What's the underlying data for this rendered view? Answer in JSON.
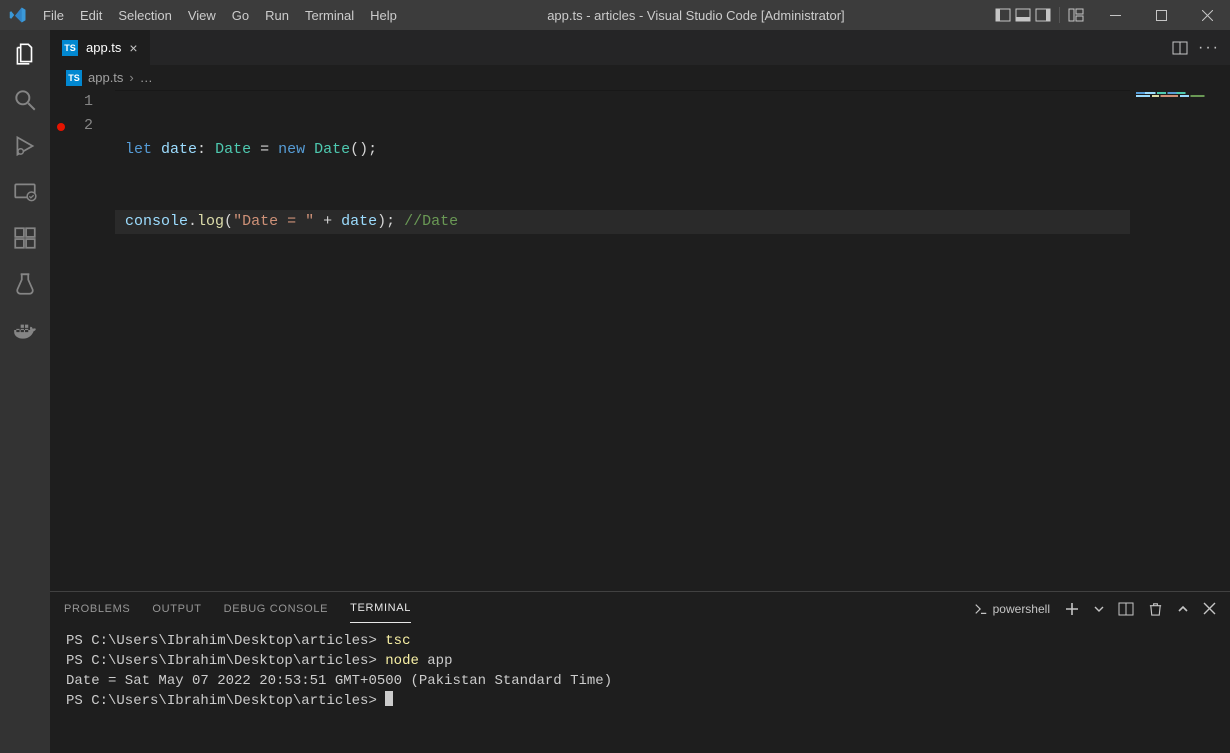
{
  "window": {
    "title": "app.ts - articles - Visual Studio Code [Administrator]"
  },
  "menu": [
    "File",
    "Edit",
    "Selection",
    "View",
    "Go",
    "Run",
    "Terminal",
    "Help"
  ],
  "tabs": {
    "open": [
      {
        "label": "app.ts"
      }
    ]
  },
  "breadcrumb": {
    "file": "app.ts",
    "tail": "…"
  },
  "code": {
    "lines": [
      {
        "num": "1"
      },
      {
        "num": "2"
      }
    ],
    "l1": {
      "kw1": "let",
      "var": "date",
      "colon": ": ",
      "type": "Date",
      "eq": " = ",
      "kw2": "new",
      "sp": " ",
      "ctor": "Date",
      "paren": "();"
    },
    "l2": {
      "obj": "console",
      "dot": ".",
      "fn": "log",
      "open": "(",
      "str": "\"Date = \"",
      "plus": " + ",
      "var": "date",
      "close": "); ",
      "cmt": "//Date"
    }
  },
  "panel": {
    "tabs": [
      "PROBLEMS",
      "OUTPUT",
      "DEBUG CONSOLE",
      "TERMINAL"
    ],
    "active": "TERMINAL",
    "shellName": "powershell",
    "terminal": {
      "prompt": "PS C:\\Users\\Ibrahim\\Desktop\\articles>",
      "cmd1": "tsc",
      "cmd2a": "node",
      "cmd2b": "app",
      "output": "Date = Sat May 07 2022 20:53:51 GMT+0500 (Pakistan Standard Time)"
    }
  }
}
